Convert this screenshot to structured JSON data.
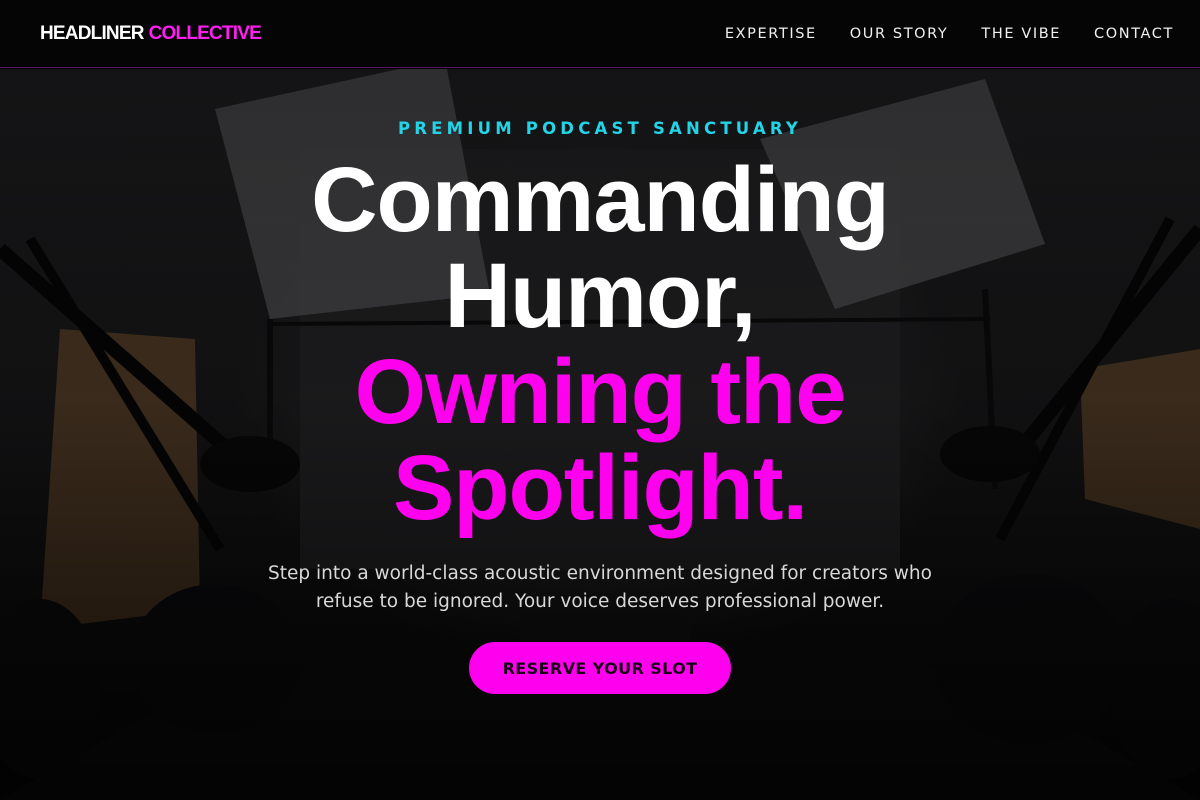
{
  "brand": {
    "name_primary": "HEADLINER",
    "name_accent": "COLLECTIVE"
  },
  "nav": {
    "items": [
      {
        "label": "EXPERTISE"
      },
      {
        "label": "OUR STORY"
      },
      {
        "label": "THE VIBE"
      },
      {
        "label": "CONTACT"
      }
    ]
  },
  "hero": {
    "eyebrow": "PREMIUM PODCAST SANCTUARY",
    "headline_line1": "Commanding",
    "headline_line2": "Humor,",
    "headline_line3": "Owning the",
    "headline_line4": "Spotlight.",
    "subtext": "Step into a world-class acoustic environment designed for creators who refuse to be ignored. Your voice deserves professional power.",
    "cta_label": "RESERVE YOUR SLOT"
  },
  "colors": {
    "accent_pink": "#ff00ee",
    "accent_cyan": "#23d3e6",
    "background": "#000000"
  }
}
